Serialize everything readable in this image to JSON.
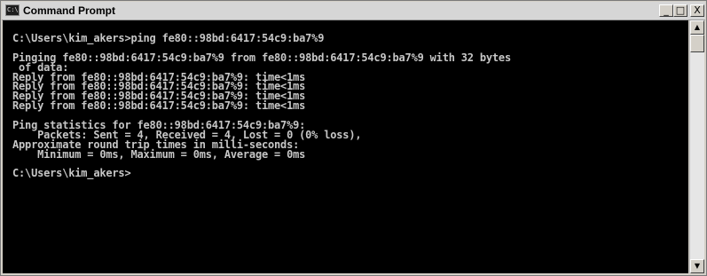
{
  "window": {
    "title": "Command Prompt",
    "icon_name": "console-icon",
    "icon_glyph": "C:\\",
    "controls": {
      "minimize_glyph": "_",
      "maximize_glyph": "□",
      "close_glyph": "X"
    }
  },
  "console": {
    "lines": [
      "C:\\Users\\kim_akers>ping fe80::98bd:6417:54c9:ba7%9",
      "",
      "Pinging fe80::98bd:6417:54c9:ba7%9 from fe80::98bd:6417:54c9:ba7%9 with 32 bytes",
      " of data:",
      "Reply from fe80::98bd:6417:54c9:ba7%9: time<1ms",
      "Reply from fe80::98bd:6417:54c9:ba7%9: time<1ms",
      "Reply from fe80::98bd:6417:54c9:ba7%9: time<1ms",
      "Reply from fe80::98bd:6417:54c9:ba7%9: time<1ms",
      "",
      "Ping statistics for fe80::98bd:6417:54c9:ba7%9:",
      "    Packets: Sent = 4, Received = 4, Lost = 0 (0% loss),",
      "Approximate round trip times in milli-seconds:",
      "    Minimum = 0ms, Maximum = 0ms, Average = 0ms",
      "",
      "C:\\Users\\kim_akers>"
    ]
  },
  "scrollbar": {
    "up_glyph": "▲",
    "down_glyph": "▼"
  },
  "colors": {
    "console_background": "#000000",
    "console_text": "#c6c6c6",
    "titlebar": "#d6d6d6"
  }
}
